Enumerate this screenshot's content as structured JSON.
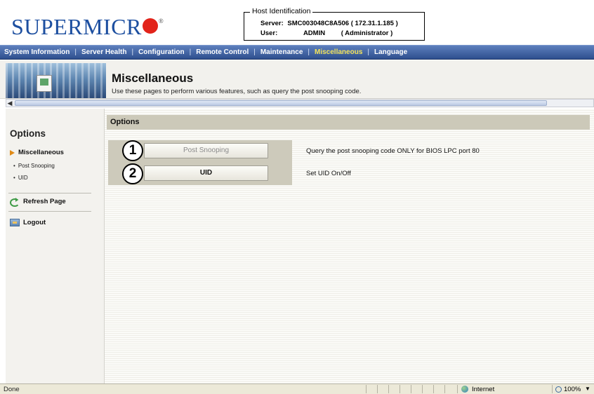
{
  "header": {
    "logo_text": "SUPERMICR",
    "logo_reg": "®",
    "host": {
      "title": "Host Identification",
      "server_label": "Server:",
      "server_value": "SMC003048C8A506 ( 172.31.1.185 )",
      "user_label": "User:",
      "user_value": "ADMIN",
      "user_role": "( Administrator )"
    }
  },
  "nav": {
    "items": [
      {
        "label": "System Information"
      },
      {
        "label": "Server Health"
      },
      {
        "label": "Configuration"
      },
      {
        "label": "Remote Control"
      },
      {
        "label": "Maintenance"
      },
      {
        "label": "Miscellaneous"
      },
      {
        "label": "Language"
      }
    ],
    "active_index": 5,
    "active_color": "#f2e35b"
  },
  "banner": {
    "title": "Miscellaneous",
    "subtitle": "Use these pages to perform various features, such as query the post snooping code."
  },
  "sidebar": {
    "title": "Options",
    "section_label": "Miscellaneous",
    "sub_items": [
      "Post Snooping",
      "UID"
    ],
    "refresh_label": "Refresh Page",
    "logout_label": "Logout"
  },
  "main": {
    "section_title": "Options",
    "options": [
      {
        "callout": "1",
        "button": "Post Snooping",
        "description": "Query the post snooping code ONLY for BIOS LPC port 80"
      },
      {
        "callout": "2",
        "button": "UID",
        "description": "Set UID On/Off"
      }
    ]
  },
  "statusbar": {
    "status": "Done",
    "zone": "Internet",
    "zoom": "100%"
  },
  "colors": {
    "nav_bg": "#2e4f8e",
    "logo_blue": "#1d4fa0",
    "logo_dot": "#e2231a",
    "section_bar": "#ccc9b9"
  }
}
